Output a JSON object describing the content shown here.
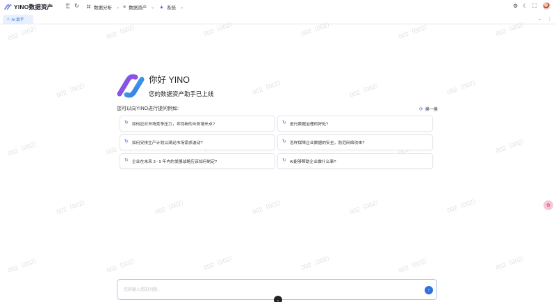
{
  "header": {
    "brand": "YINO数据资产",
    "menus": [
      {
        "label": "数据分析",
        "icon": "analysis-icon"
      },
      {
        "label": "数据资产",
        "icon": "list-icon"
      },
      {
        "label": "系统",
        "icon": "system-icon"
      }
    ],
    "collapse_icon": "sidebar-collapse-icon",
    "refresh_icon": "refresh-icon",
    "tools": [
      "settings-icon",
      "moon-icon",
      "fullscreen-icon"
    ]
  },
  "tabs": [
    {
      "label": "AI 助手",
      "active": true
    }
  ],
  "watermark": "002（002）",
  "welcome": {
    "greeting": "你好 YINO",
    "subtitle": "您的数据资产助手已上线"
  },
  "ask_label": "您可以向YINO进行提问例如:",
  "refresh_label": "换一换",
  "questions": [
    "如何应对市场竞争压力，寻找新的业务增长点?",
    "进行数据治理的好处?",
    "如何安排生产计划以满足市场需求波动?",
    "怎样保障企业数据的安全，防范网络攻击?",
    "企业在未来 3 - 5 年内的发展战略应该如何制定?",
    "AI能够帮助企业做什么事?"
  ],
  "input": {
    "placeholder": "您的输入您的问题...",
    "value": ""
  },
  "colors": {
    "accent": "#2f6fe0",
    "tab_bg": "#e8f0fe",
    "card_border": "#e4e7ed"
  }
}
